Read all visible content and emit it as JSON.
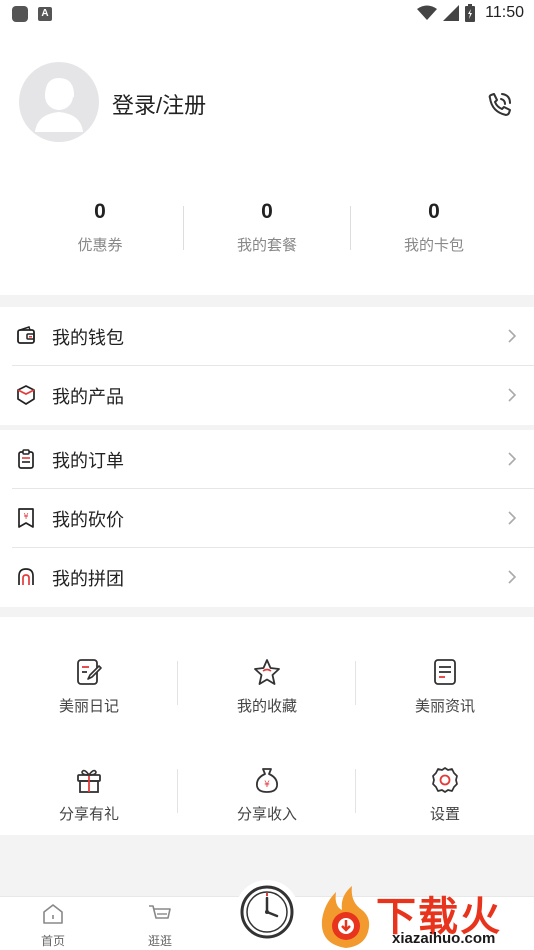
{
  "status_bar": {
    "time": "11:50"
  },
  "profile": {
    "login_label": "登录/注册"
  },
  "stats": [
    {
      "value": "0",
      "label": "优惠券"
    },
    {
      "value": "0",
      "label": "我的套餐"
    },
    {
      "value": "0",
      "label": "我的卡包"
    }
  ],
  "menu_group_1": [
    {
      "label": "我的钱包",
      "icon": "wallet-icon"
    },
    {
      "label": "我的产品",
      "icon": "box-icon"
    }
  ],
  "menu_group_2": [
    {
      "label": "我的订单",
      "icon": "clipboard-icon"
    },
    {
      "label": "我的砍价",
      "icon": "bargain-tag-icon"
    },
    {
      "label": "我的拼团",
      "icon": "group-people-icon"
    }
  ],
  "features": [
    {
      "label": "美丽日记",
      "icon": "diary-icon"
    },
    {
      "label": "我的收藏",
      "icon": "star-icon"
    },
    {
      "label": "美丽资讯",
      "icon": "news-icon"
    },
    {
      "label": "分享有礼",
      "icon": "gift-icon"
    },
    {
      "label": "分享收入",
      "icon": "money-bag-icon"
    },
    {
      "label": "设置",
      "icon": "gear-icon"
    }
  ],
  "tabbar": [
    {
      "label": "首页",
      "icon": "home-icon"
    },
    {
      "label": "逛逛",
      "icon": "cart-icon"
    }
  ],
  "watermark": {
    "text": "下载火",
    "url": "xiazaihuo.com"
  },
  "colors": {
    "accent": "#e8341c",
    "icon_red": "#e33b3b",
    "bg": "#f3f3f3"
  }
}
